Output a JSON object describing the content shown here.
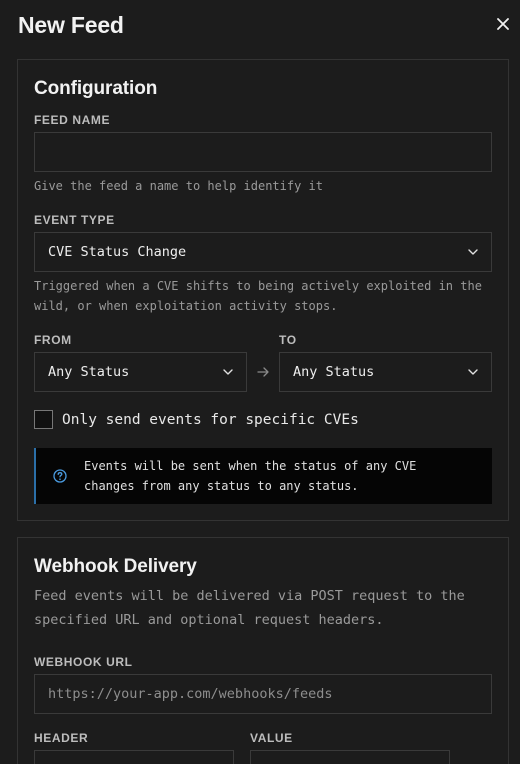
{
  "dialog": {
    "title": "New Feed",
    "close_icon": "close-icon"
  },
  "configuration": {
    "title": "Configuration",
    "feed_name": {
      "label": "FEED NAME",
      "value": "",
      "placeholder": "",
      "help": "Give the feed a name to help identify it"
    },
    "event_type": {
      "label": "EVENT TYPE",
      "selected": "CVE Status Change",
      "help": "Triggered when a CVE shifts to being actively exploited in the wild, or when exploitation activity stops."
    },
    "from": {
      "label": "FROM",
      "selected": "Any Status"
    },
    "to": {
      "label": "TO",
      "selected": "Any Status"
    },
    "specific_cves": {
      "label": "Only send events for specific CVEs",
      "checked": false
    },
    "info": {
      "icon": "help-circle-icon",
      "text_line1": "Events will be sent when the status of any CVE",
      "text_line2": "changes from any status to any status."
    }
  },
  "webhook": {
    "title": "Webhook Delivery",
    "description_line1": "Feed events will be delivered via POST request to the",
    "description_line2": "specified URL and optional request headers.",
    "url": {
      "label": "WEBHOOK URL",
      "value": "",
      "placeholder": "https://your-app.com/webhooks/feeds"
    },
    "header": {
      "label": "HEADER"
    },
    "value": {
      "label": "VALUE"
    }
  },
  "colors": {
    "background": "#1c1c1c",
    "border": "#333333",
    "info_background": "#050505",
    "info_accent": "#2b6fa8"
  }
}
